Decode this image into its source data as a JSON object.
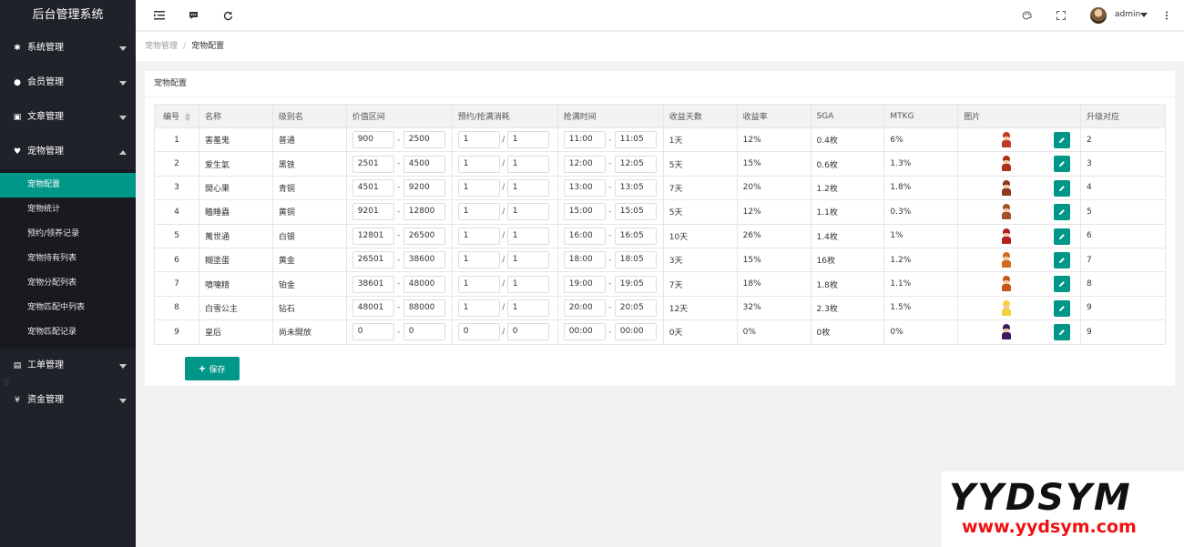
{
  "app": {
    "title": "后台管理系统"
  },
  "sidebar": {
    "groups": [
      {
        "label": "系统管理",
        "icon": "gear-icon"
      },
      {
        "label": "会员管理",
        "icon": "users-icon"
      },
      {
        "label": "文章管理",
        "icon": "copy-icon"
      },
      {
        "label": "宠物管理",
        "icon": "heart-icon"
      }
    ],
    "pet_sub": [
      {
        "label": "宠物配置",
        "active": true
      },
      {
        "label": "宠物统计"
      },
      {
        "label": "预约/领养记录"
      },
      {
        "label": "宠物持有列表"
      },
      {
        "label": "宠物分配列表"
      },
      {
        "label": "宠物匹配中列表"
      },
      {
        "label": "宠物匹配记录"
      }
    ],
    "after": [
      {
        "label": "工单管理",
        "icon": "file-icon"
      },
      {
        "label": "资金管理",
        "icon": "yen-icon"
      }
    ]
  },
  "header": {
    "user": "admin"
  },
  "breadcrumb": {
    "parent": "宠物管理",
    "sep": "/",
    "current": "宠物配置"
  },
  "card": {
    "title": "宠物配置"
  },
  "table": {
    "headers": [
      "编号",
      "名称",
      "级别名",
      "价值区间",
      "预约/抢满消耗",
      "抢满时间",
      "收益天数",
      "收益率",
      "SGA",
      "MTKG",
      "图片",
      "升级对应"
    ],
    "rows": [
      {
        "id": "1",
        "name": "害羞鬼",
        "level": "普通",
        "vmin": "900",
        "vmax": "2500",
        "c1": "1",
        "c2": "1",
        "t1": "11:00",
        "t2": "11:05",
        "days": "1天",
        "rate": "12%",
        "sga": "0.4枚",
        "mtkg": "6%",
        "up": "2",
        "color": "#c0392b"
      },
      {
        "id": "2",
        "name": "爱生氣",
        "level": "黑铁",
        "vmin": "2501",
        "vmax": "4500",
        "c1": "1",
        "c2": "1",
        "t1": "12:00",
        "t2": "12:05",
        "days": "5天",
        "rate": "15%",
        "sga": "0.6枚",
        "mtkg": "1.3%",
        "up": "3",
        "color": "#b03020"
      },
      {
        "id": "3",
        "name": "開心果",
        "level": "青铜",
        "vmin": "4501",
        "vmax": "9200",
        "c1": "1",
        "c2": "1",
        "t1": "13:00",
        "t2": "13:05",
        "days": "7天",
        "rate": "20%",
        "sga": "1.2枚",
        "mtkg": "1.8%",
        "up": "4",
        "color": "#8e3a1e"
      },
      {
        "id": "4",
        "name": "瞌睡蟲",
        "level": "黄铜",
        "vmin": "9201",
        "vmax": "12800",
        "c1": "1",
        "c2": "1",
        "t1": "15:00",
        "t2": "15:05",
        "days": "5天",
        "rate": "12%",
        "sga": "1.1枚",
        "mtkg": "0.3%",
        "up": "5",
        "color": "#a0522d"
      },
      {
        "id": "5",
        "name": "萬世通",
        "level": "白银",
        "vmin": "12801",
        "vmax": "26500",
        "c1": "1",
        "c2": "1",
        "t1": "16:00",
        "t2": "16:05",
        "days": "10天",
        "rate": "26%",
        "sga": "1.4枚",
        "mtkg": "1%",
        "up": "6",
        "color": "#b22222"
      },
      {
        "id": "6",
        "name": "糊塗蛋",
        "level": "黄金",
        "vmin": "26501",
        "vmax": "38600",
        "c1": "1",
        "c2": "1",
        "t1": "18:00",
        "t2": "18:05",
        "days": "3天",
        "rate": "15%",
        "sga": "16枚",
        "mtkg": "1.2%",
        "up": "7",
        "color": "#d2691e"
      },
      {
        "id": "7",
        "name": "噴嚏精",
        "level": "铂金",
        "vmin": "38601",
        "vmax": "48000",
        "c1": "1",
        "c2": "1",
        "t1": "19:00",
        "t2": "19:05",
        "days": "7天",
        "rate": "18%",
        "sga": "1.8枚",
        "mtkg": "1.1%",
        "up": "8",
        "color": "#c8551a"
      },
      {
        "id": "8",
        "name": "白雪公主",
        "level": "钻石",
        "vmin": "48001",
        "vmax": "88000",
        "c1": "1",
        "c2": "1",
        "t1": "20:00",
        "t2": "20:05",
        "days": "12天",
        "rate": "32%",
        "sga": "2.3枚",
        "mtkg": "1.5%",
        "up": "9",
        "color": "#f4d03f"
      },
      {
        "id": "9",
        "name": "皇后",
        "level": "尚未開放",
        "vmin": "0",
        "vmax": "0",
        "c1": "0",
        "c2": "0",
        "t1": "00:00",
        "t2": "00:00",
        "days": "0天",
        "rate": "0%",
        "sga": "0枚",
        "mtkg": "0%",
        "up": "9",
        "color": "#3b1f5c"
      }
    ]
  },
  "actions": {
    "save": "保存"
  },
  "watermark": {
    "brand": "YYDSYM",
    "url": "www.yydsym.com"
  },
  "colors": {
    "accent": "#009688",
    "sidebar": "#20222a"
  }
}
